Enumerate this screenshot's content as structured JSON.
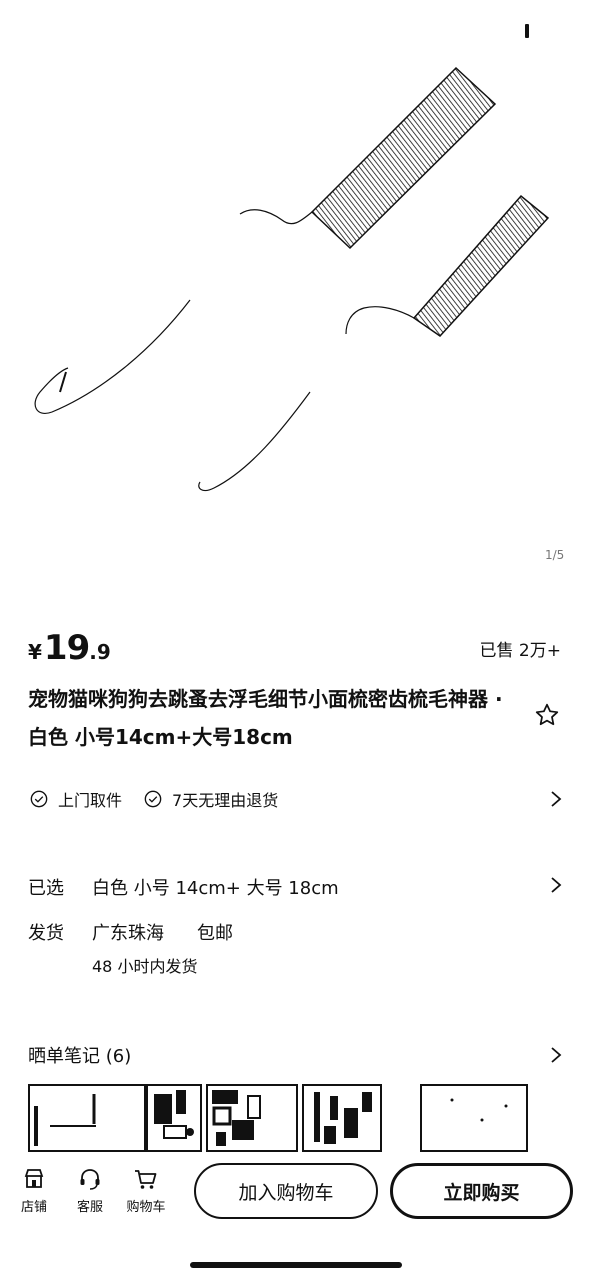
{
  "product": {
    "price_symbol": "¥",
    "price_integer": "19",
    "price_decimal": ".9",
    "sold": "已售 2万+",
    "title": "宠物猫咪狗狗去跳蚤去浮毛细节小面梳密齿梳毛神器 · 白色 小号14cm+大号18cm",
    "image_counter": "1/5"
  },
  "services": {
    "items": [
      "上门取件",
      "7天无理由退货"
    ]
  },
  "selection": {
    "label": "已选",
    "value": "白色 小号 14cm+ 大号 18cm"
  },
  "shipping": {
    "label": "发货",
    "origin": "广东珠海",
    "fee": "包邮",
    "time": "48 小时内发货"
  },
  "notes": {
    "title": "晒单笔记 (6)"
  },
  "bottom_bar": {
    "tabs": [
      {
        "label": "店铺",
        "icon": "store-icon"
      },
      {
        "label": "客服",
        "icon": "headset-icon"
      },
      {
        "label": "购物车",
        "icon": "cart-icon"
      }
    ],
    "add_to_cart": "加入购物车",
    "buy_now": "立即购买"
  }
}
